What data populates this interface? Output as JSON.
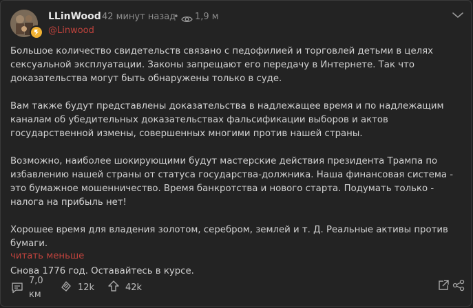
{
  "post": {
    "username": "LLinWood",
    "time": "42 минут назад",
    "separator": "•",
    "views": "1,9 м",
    "handle": "@Linwood",
    "paragraphs": [
      "Большое количество свидетельств связано с педофилией и торговлей детьми в целях сексуальной эксплуатации. Законы запрещают его передачу в Интернете. Так что доказательства могут быть обнаружены только в суде.",
      "Вам также будут представлены доказательства в надлежащее время и по надлежащим каналам об убедительных доказательствах фальсификации выборов и актов государственной измены, совершенных многими против нашей страны.",
      "Возможно, наиболее шокирующими будут мастерские действия президента Трампа по избавлению нашей страны от статуса государства-должника. Наша финансовая система - это бумажное мошенничество. Время банкротства и нового старта. Подумать только - налога на прибыль нет!",
      "Хорошее время для владения золотом, серебром, землей и т. Д. Реальные активы против бумаги.",
      "Снова 1776 год. Оставайтесь в курсе."
    ],
    "read_less": "читать меньше"
  },
  "actions": {
    "comments_line1": "7,0",
    "comments_line2": "км",
    "reposts": "12k",
    "likes": "42k"
  },
  "icons": {
    "views": "eye-icon",
    "menu": "chevron-down-icon",
    "comments": "comment-icon",
    "reposts": "repost-icon",
    "likes": "upvote-icon",
    "share": "share-icon",
    "link": "link-share-icon",
    "badge": "verified-badge-icon"
  },
  "colors": {
    "background": "#232323",
    "accent": "#c0433d",
    "badge": "#f0b233",
    "text": "#d2d2d2",
    "muted": "#8d8d8d"
  }
}
